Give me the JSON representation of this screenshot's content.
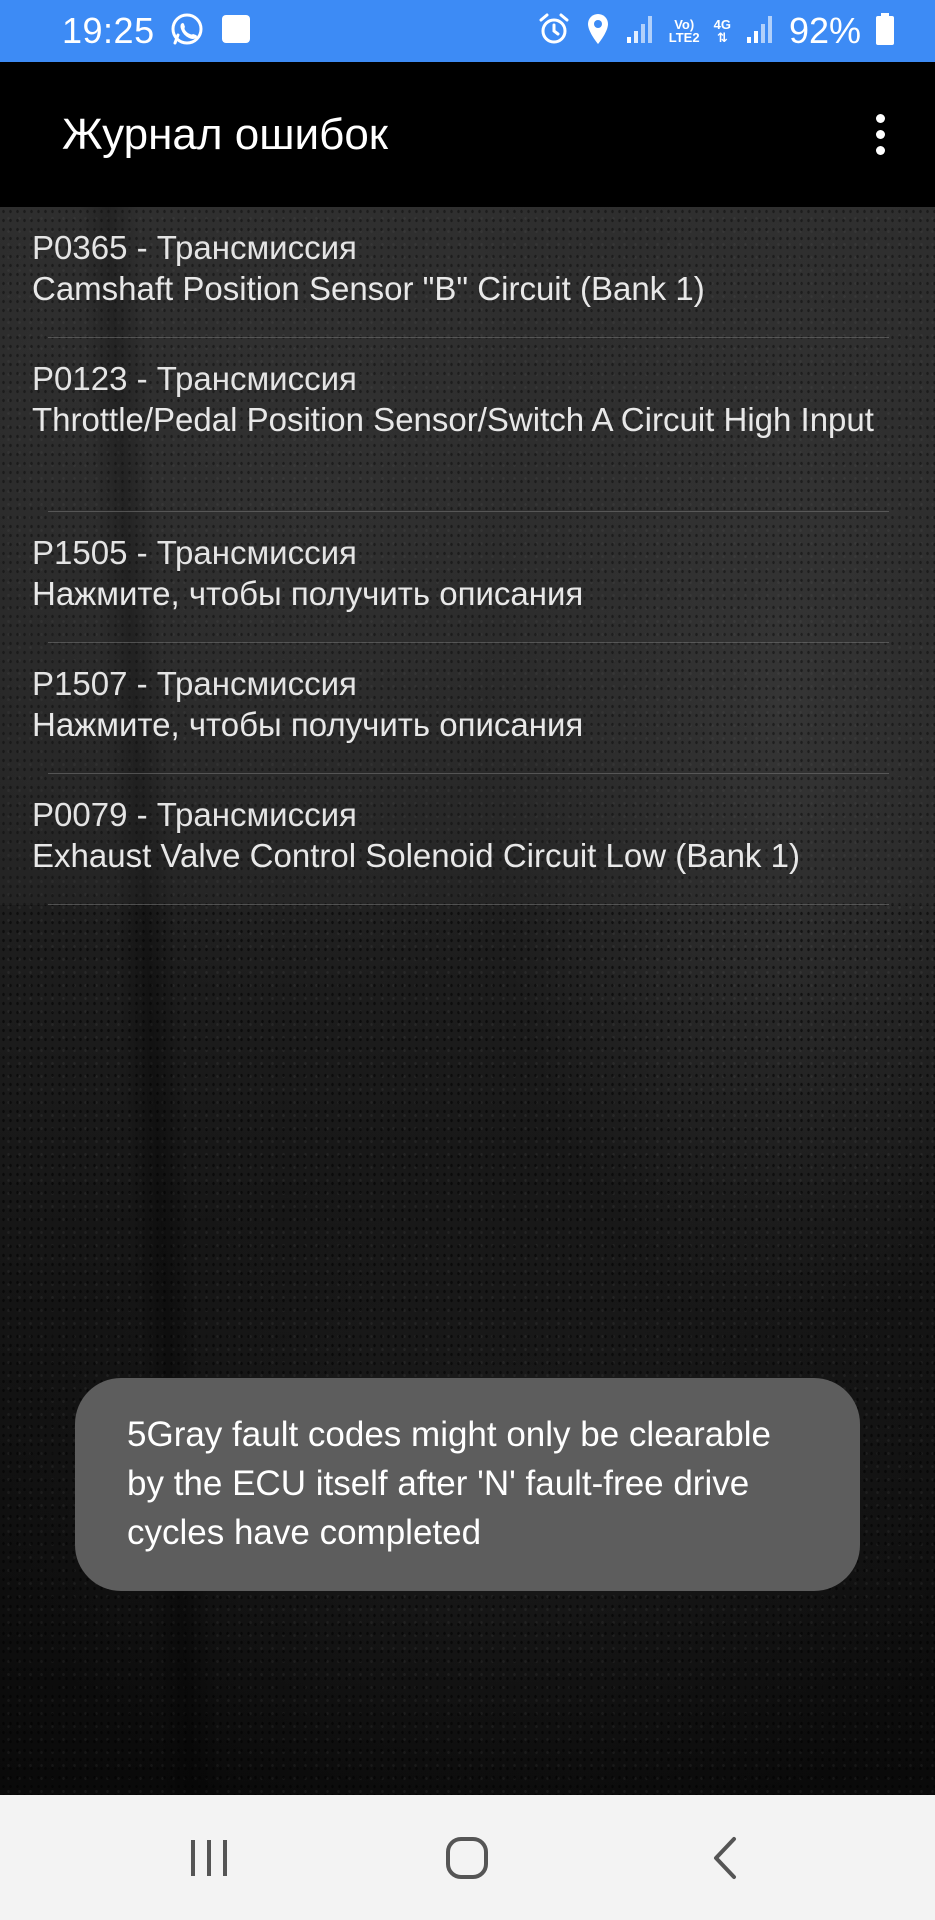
{
  "status_bar": {
    "time": "19:25",
    "network": [
      "Vo)",
      "LTE2"
    ],
    "network_type": "4G",
    "battery": "92%",
    "icons": [
      "whatsapp-icon",
      "notification-square-icon",
      "alarm-icon",
      "location-icon",
      "signal-icon",
      "battery-icon"
    ],
    "bg_color": "#3d8bf5"
  },
  "app_bar": {
    "title": "Журнал ошибок",
    "menu_icon": "overflow-menu-icon"
  },
  "codes": [
    {
      "title": "P0365 - Трансмиссия",
      "description": "Camshaft Position Sensor \"B\" Circuit (Bank 1)"
    },
    {
      "title": "P0123 - Трансмиссия",
      "description": "Throttle/Pedal Position Sensor/Switch A Circuit High Input"
    },
    {
      "title": "P1505 - Трансмиссия",
      "description": "Нажмите, чтобы получить описания"
    },
    {
      "title": "P1507 - Трансмиссия",
      "description": "Нажмите, чтобы получить описания"
    },
    {
      "title": "P0079 - Трансмиссия",
      "description": "Exhaust Valve Control Solenoid Circuit Low (Bank 1)"
    }
  ],
  "toast": {
    "message": "5Gray fault codes might only be clearable by the ECU itself after 'N' fault-free drive cycles have completed",
    "bg_color": "#5d5d5d"
  },
  "nav_bar": {
    "icons": [
      "recent-apps-icon",
      "home-icon",
      "back-icon"
    ]
  }
}
